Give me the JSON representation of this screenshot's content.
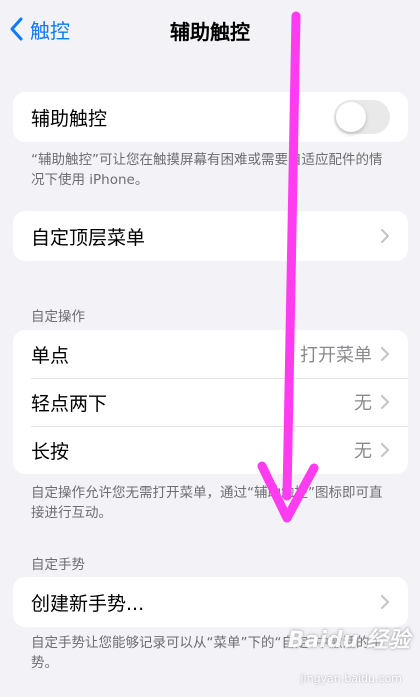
{
  "nav": {
    "back_label": "触控",
    "title": "辅助触控"
  },
  "assistive_touch": {
    "label": "辅助触控",
    "enabled": false,
    "footnote": "“辅助触控”可让您在触摸屏幕有困难或需要自适应配件的情况下使用 iPhone。"
  },
  "top_menu": {
    "label": "自定顶层菜单"
  },
  "custom_actions": {
    "header": "自定操作",
    "rows": [
      {
        "label": "单点",
        "value": "打开菜单"
      },
      {
        "label": "轻点两下",
        "value": "无"
      },
      {
        "label": "长按",
        "value": "无"
      }
    ],
    "footnote": "自定操作允许您无需打开菜单，通过“辅助触控”图标即可直接进行互动。"
  },
  "custom_gestures": {
    "header": "自定手势",
    "create_label": "创建新手势...",
    "footnote": "自定手势让您能够记录可以从“菜单”下的“自定”中激活的手势。"
  },
  "watermark": {
    "text": "Baidu 经验",
    "sub": "jingyan.baidu.com"
  },
  "colors": {
    "accent": "#0a7aff",
    "background": "#f2f2f7",
    "annotation_arrow": "#ff3cf0",
    "toggle_off": "#e9e9ea"
  },
  "icons": {
    "back": "chevron-left-icon",
    "disclosure": "chevron-right-icon"
  }
}
